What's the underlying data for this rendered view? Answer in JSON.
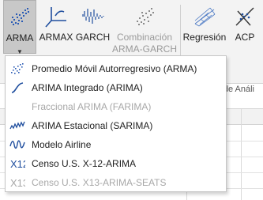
{
  "ribbon": {
    "buttons": [
      {
        "label": "ARMA",
        "icon": "arma-scatter-icon",
        "active": true
      },
      {
        "label": "ARMAX",
        "icon": "armax-axes-icon"
      },
      {
        "label": "GARCH",
        "icon": "garch-wave-icon"
      },
      {
        "label": "Combinación",
        "label2": "ARMA-GARCH",
        "icon": "combination-scatter-icon",
        "disabled": true
      },
      {
        "label": "Regresión",
        "icon": "regression-icon"
      },
      {
        "label": "ACP",
        "icon": "pca-icon"
      }
    ],
    "group_label": "or de Análi"
  },
  "sheet": {
    "visible_col_header": "H"
  },
  "menu": {
    "items": [
      {
        "label": "Promedio Móvil Autorregresivo (ARMA)",
        "icon": "arma-scatter-icon",
        "disabled": false
      },
      {
        "label": "ARIMA Integrado (ARIMA)",
        "icon": "integrated-curve-icon",
        "disabled": false
      },
      {
        "label": "Fraccional ARIMA (FARIMA)",
        "icon": "",
        "disabled": true
      },
      {
        "label": "ARIMA Estacional (SARIMA)",
        "icon": "seasonal-wave-icon",
        "disabled": false
      },
      {
        "label": "Modelo Airline",
        "icon": "airline-wave-icon",
        "disabled": false
      },
      {
        "label": "Censo U.S. X-12-ARIMA",
        "icon": "x12-icon",
        "icon_text": "X12",
        "disabled": false
      },
      {
        "label": "Censo U.S. X13-ARIMA-SEATS",
        "icon": "x13-icon",
        "icon_text": "X13",
        "disabled": true
      }
    ]
  },
  "colors": {
    "accent": "#1f4e9e",
    "disabled": "#a8a8a8",
    "active_bg": "#c8c8c8"
  }
}
